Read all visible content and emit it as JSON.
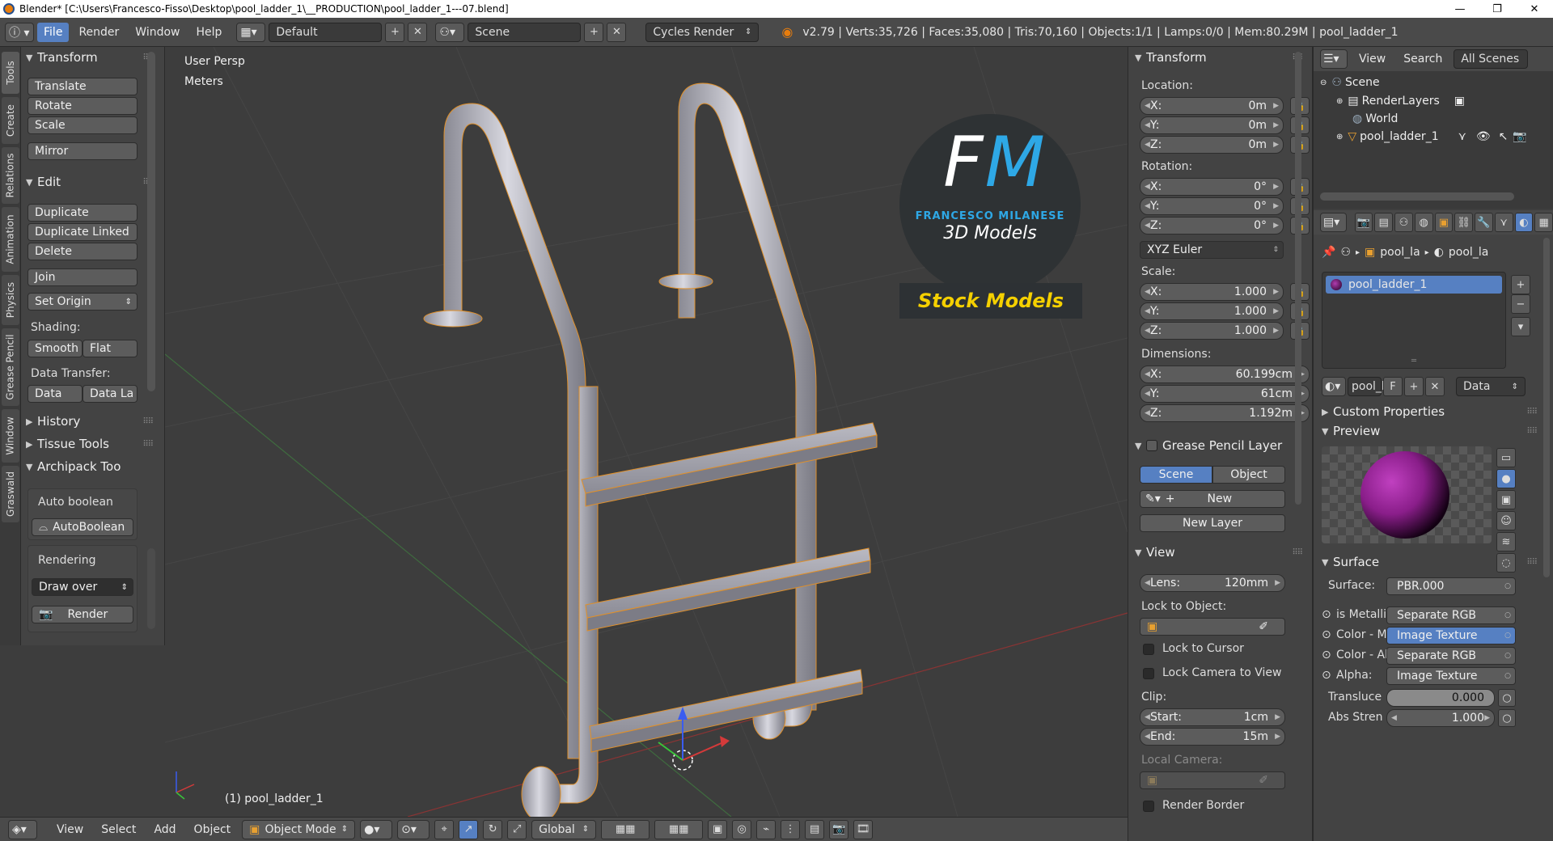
{
  "window": {
    "title": "Blender* [C:\\Users\\Francesco-Fisso\\Desktop\\pool_ladder_1\\__PRODUCTION\\pool_ladder_1---07.blend]",
    "minimize": "—",
    "maximize": "❐",
    "close": "✕"
  },
  "header": {
    "menus": [
      "File",
      "Render",
      "Window",
      "Help"
    ],
    "layout": "Default",
    "scene": "Scene",
    "engine": "Cycles Render",
    "stats": "v2.79 | Verts:35,726 | Faces:35,080 | Tris:70,160 | Objects:1/1 | Lamps:0/0 | Mem:80.29M | pool_ladder_1"
  },
  "left_tabs": [
    "Tools",
    "Create",
    "Relations",
    "Animation",
    "Physics",
    "Grease Pencil",
    "Window",
    "Graswald"
  ],
  "toolshelf": {
    "transform_title": "Transform",
    "translate": "Translate",
    "rotate": "Rotate",
    "scale": "Scale",
    "mirror": "Mirror",
    "edit_title": "Edit",
    "duplicate": "Duplicate",
    "duplicate_linked": "Duplicate Linked",
    "delete": "Delete",
    "join": "Join",
    "set_origin": "Set Origin",
    "shading_label": "Shading:",
    "smooth": "Smooth",
    "flat": "Flat",
    "data_transfer_label": "Data Transfer:",
    "data": "Data",
    "data_la": "Data La",
    "history": "History",
    "tissue_tools": "Tissue Tools",
    "archipack": "Archipack Too",
    "auto_boolean_label": "Auto boolean",
    "autoboolean_btn": "AutoBoolean",
    "rendering_label": "Rendering",
    "draw_over": "Draw over",
    "render": "Render"
  },
  "viewport": {
    "view_name": "User Persp",
    "units": "Meters",
    "object_label": "(1) pool_ladder_1",
    "logo_letters": "FM",
    "logo_name": "FRANCESCO MILANESE",
    "logo_sub": "3D Models",
    "logo_banner": "Stock Models"
  },
  "npanel": {
    "transform_title": "Transform",
    "location_label": "Location:",
    "loc": [
      {
        "axis": "X:",
        "value": "0m"
      },
      {
        "axis": "Y:",
        "value": "0m"
      },
      {
        "axis": "Z:",
        "value": "0m"
      }
    ],
    "rotation_label": "Rotation:",
    "rot": [
      {
        "axis": "X:",
        "value": "0°"
      },
      {
        "axis": "Y:",
        "value": "0°"
      },
      {
        "axis": "Z:",
        "value": "0°"
      }
    ],
    "rotation_mode": "XYZ Euler",
    "scale_label": "Scale:",
    "scl": [
      {
        "axis": "X:",
        "value": "1.000"
      },
      {
        "axis": "Y:",
        "value": "1.000"
      },
      {
        "axis": "Z:",
        "value": "1.000"
      }
    ],
    "dimensions_label": "Dimensions:",
    "dim": [
      {
        "axis": "X:",
        "value": "60.199cm"
      },
      {
        "axis": "Y:",
        "value": "61cm"
      },
      {
        "axis": "Z:",
        "value": "1.192m"
      }
    ],
    "grease_title": "Grease Pencil Layer",
    "scene_btn": "Scene",
    "object_btn": "Object",
    "new_btn": "New",
    "new_layer_btn": "New Layer",
    "view_title": "View",
    "lens_label": "Lens:",
    "lens_value": "120mm",
    "lock_object_label": "Lock to Object:",
    "lock_cursor": "Lock to Cursor",
    "lock_camera": "Lock Camera to View",
    "clip_label": "Clip:",
    "clip_start_label": "Start:",
    "clip_start": "1cm",
    "clip_end_label": "End:",
    "clip_end": "15m",
    "local_camera_label": "Local Camera:",
    "render_border": "Render Border"
  },
  "outliner": {
    "view_menu": "View",
    "search_menu": "Search",
    "filter": "All Scenes",
    "rows": [
      "Scene",
      "RenderLayers",
      "World",
      "pool_ladder_1"
    ]
  },
  "properties": {
    "breadcrumb_1": "pool_la",
    "breadcrumb_2": "pool_la",
    "material_slot": "pool_ladder_1",
    "mat_name": "pool_l",
    "mat_f": "F",
    "link_dropdown": "Data",
    "custom_props": "Custom Properties",
    "preview": "Preview",
    "surface_title": "Surface",
    "surface_label": "Surface:",
    "surface_value": "PBR.000",
    "inputs": [
      {
        "label": "is Metallic",
        "value": "Separate RGB"
      },
      {
        "label": "Color - Ma",
        "value": "Image Texture"
      },
      {
        "label": "Color - Ab",
        "value": "Separate RGB"
      },
      {
        "label": "Alpha:",
        "value": "Image Texture"
      }
    ],
    "transluce_label": "Transluce",
    "transluce_value": "0.000",
    "abs_stren_label": "Abs Stren",
    "abs_stren_value": "1.000"
  },
  "footer": {
    "view": "View",
    "select": "Select",
    "add": "Add",
    "object": "Object",
    "mode": "Object Mode",
    "orientation": "Global"
  },
  "colors": {
    "accent": "#5680c2",
    "logo_blue": "#2ea8e6",
    "logo_banner_text": "#f5d000"
  }
}
